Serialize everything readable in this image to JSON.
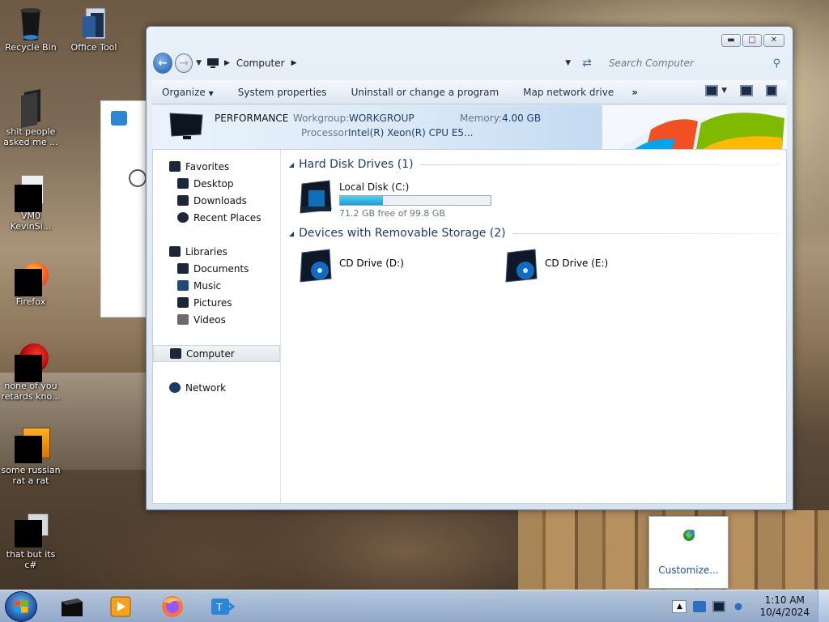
{
  "desktop": {
    "icons": [
      {
        "label": "Recycle Bin"
      },
      {
        "label": "Office Tool"
      },
      {
        "label": "shit people asked me ..."
      },
      {
        "label": "VM0 KevinSi..."
      },
      {
        "label": "Firefox"
      },
      {
        "label": "none of you retards kno..."
      },
      {
        "label": "some russian rat a rat"
      },
      {
        "label": "that but its c#"
      }
    ]
  },
  "window": {
    "address": {
      "segment": "Computer"
    },
    "search": {
      "placeholder": "Search Computer"
    },
    "toolbar": {
      "items": [
        "Organize",
        "System properties",
        "Uninstall or change a program",
        "Map network drive"
      ],
      "more": "»"
    },
    "details": {
      "name": "PERFORMANCE",
      "workgroup_label": "Workgroup:",
      "workgroup_value": "WORKGROUP",
      "memory_label": "Memory:",
      "memory_value": "4.00 GB",
      "processor_label": "Processor:",
      "processor_value": "Intel(R) Xeon(R) CPU E5..."
    },
    "nav": {
      "favorites": "Favorites",
      "desktop": "Desktop",
      "downloads": "Downloads",
      "recent_places": "Recent Places",
      "libraries": "Libraries",
      "documents": "Documents",
      "music": "Music",
      "pictures": "Pictures",
      "videos": "Videos",
      "computer": "Computer",
      "network": "Network"
    },
    "groups": {
      "hdd": "Hard Disk Drives (1)",
      "removable": "Devices with Removable Storage (2)"
    },
    "drives": {
      "local": {
        "name": "Local Disk (C:)",
        "free": "71.2 GB free of 99.8 GB",
        "used_fraction": 0.287
      },
      "cd_d": {
        "name": "CD Drive (D:)"
      },
      "cd_e": {
        "name": "CD Drive (E:)"
      }
    }
  },
  "tray_popup": {
    "customize": "Customize..."
  },
  "taskbar": {
    "clock": {
      "time": "1:10 AM",
      "date": "10/4/2024"
    }
  }
}
